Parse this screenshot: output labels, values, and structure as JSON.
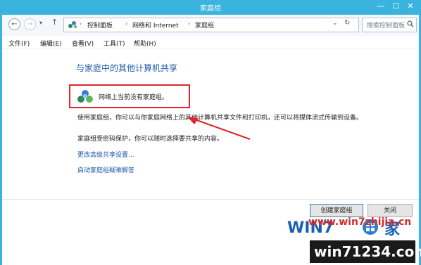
{
  "window": {
    "title": "家庭组",
    "controls": [
      "—",
      "☐",
      "✕"
    ]
  },
  "nav": {
    "back_icon": "back-arrow-icon",
    "forward_icon": "forward-arrow-icon",
    "up_icon": "up-arrow-icon",
    "breadcrumbs": [
      "控制面板",
      "网络和 Internet",
      "家庭组"
    ],
    "search_placeholder": "搜索控制面板"
  },
  "menu": {
    "items": [
      "文件(F)",
      "编辑(E)",
      "查看(V)",
      "工具(T)",
      "帮助(H)"
    ]
  },
  "main": {
    "heading": "与家庭中的其他计算机共享",
    "status_text": "网络上当前没有家庭组。",
    "description": "使用家庭组，你可以与你家庭网络上的其他计算机共享文件和打印机，还可以将媒体流式传输到设备。",
    "password_note": "家庭组受密码保护，你可以随时选择要共享的内容。",
    "links": {
      "advanced": "更改高级共享设置...",
      "troubleshoot": "启动家庭组疑难解答"
    }
  },
  "buttons": {
    "create": "创建家庭组",
    "close": "关闭"
  },
  "watermark": {
    "logo_text": "WIN7 www.win7zhijia.cn",
    "site": "win71234.com"
  },
  "colors": {
    "titlebar": "#3ab3de",
    "link": "#1e5aa8",
    "highlight": "#e0262c"
  }
}
